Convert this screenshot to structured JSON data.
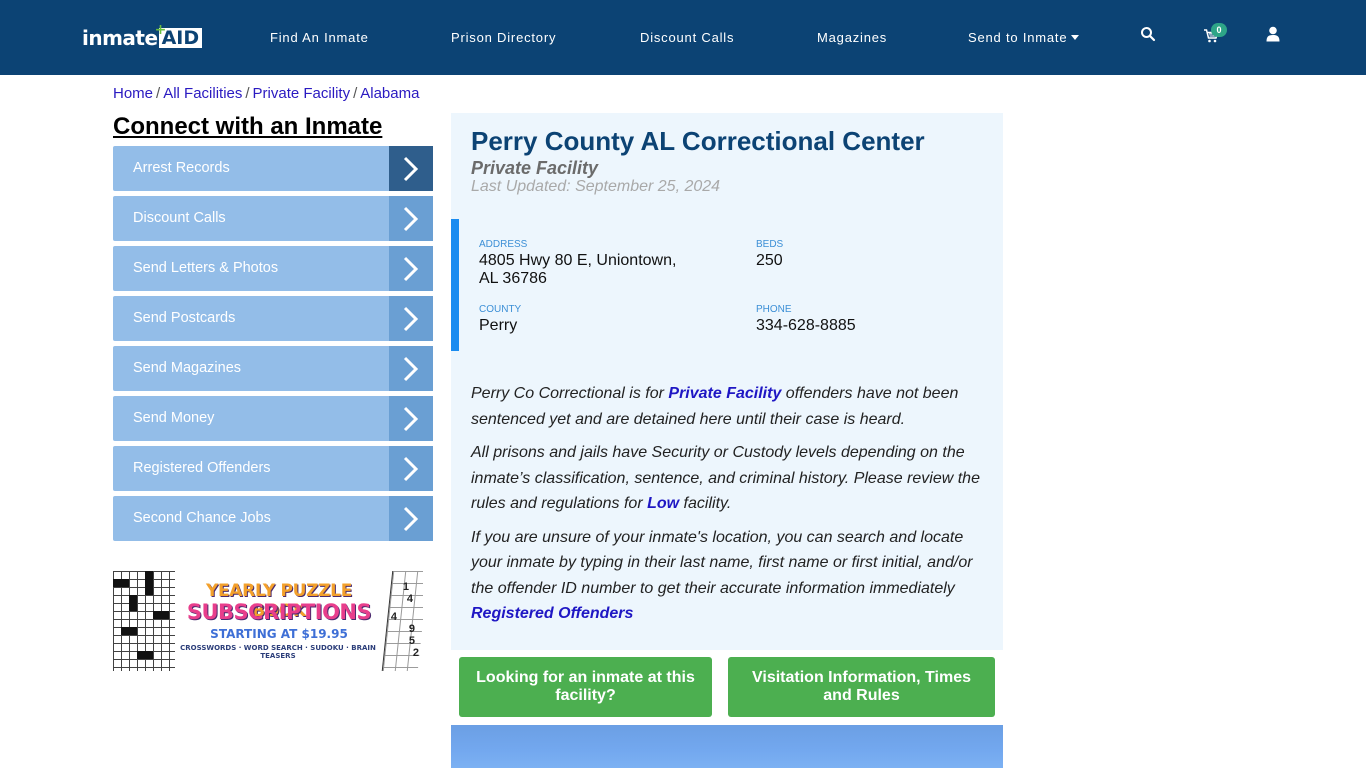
{
  "header": {
    "logo": {
      "text_main": "inmate",
      "text_accent": "AID",
      "plus": "+"
    },
    "nav": [
      {
        "label": "Find An Inmate"
      },
      {
        "label": "Prison Directory"
      },
      {
        "label": "Discount Calls"
      },
      {
        "label": "Magazines"
      },
      {
        "label": "Send to Inmate",
        "has_dropdown": true
      }
    ],
    "icons": [
      "search-icon",
      "cart-icon",
      "user-icon"
    ],
    "cart_count": "0"
  },
  "breadcrumb": {
    "items": [
      "Home",
      "All Facilities",
      "Private Facility",
      "Alabama"
    ],
    "separator": "/"
  },
  "sidebar": {
    "title": "Connect with an Inmate",
    "items": [
      {
        "label": "Arrest Records",
        "active": true
      },
      {
        "label": "Discount Calls"
      },
      {
        "label": "Send Letters & Photos"
      },
      {
        "label": "Send Postcards"
      },
      {
        "label": "Send Magazines"
      },
      {
        "label": "Send Money"
      },
      {
        "label": "Registered Offenders"
      },
      {
        "label": "Second Chance Jobs"
      }
    ],
    "ad": {
      "line1": "YEARLY PUZZLE BOOK",
      "line2": "SUBSCRIPTIONS",
      "line3": "STARTING AT $19.95",
      "line4": "CROSSWORDS · WORD SEARCH · SUDOKU · BRAIN TEASERS",
      "sudoku_numbers": [
        "1",
        "4",
        "4",
        "9",
        "5",
        "2"
      ]
    }
  },
  "facility": {
    "title": "Perry County AL Correctional Center",
    "type": "Private Facility",
    "last_updated": "Last Updated: September 25, 2024",
    "info": {
      "address_label": "ADDRESS",
      "address_line1": "4805 Hwy 80 E, Uniontown,",
      "address_line2": "AL 36786",
      "beds_label": "BEDS",
      "beds": "250",
      "county_label": "COUNTY",
      "county": "Perry",
      "phone_label": "PHONE",
      "phone": "334-628-8885"
    },
    "description": {
      "p1_before": "Perry Co Correctional is for ",
      "p1_link": "Private Facility",
      "p1_after": " offenders have not been sentenced yet and are detained here until their case is heard.",
      "p2_before": "All prisons and jails have Security or Custody levels depending on the inmate’s classification, sentence, and criminal history. Please review the rules and regulations for ",
      "p2_link": "Low",
      "p2_after": " facility.",
      "p3_text": "If you are unsure of your inmate's location, you can search and locate your inmate by typing in their last name, first name or first initial, and/or the offender ID number to get their accurate information immediately",
      "p3_link": "Registered Offenders"
    },
    "buttons": {
      "find_inmate": "Looking for an inmate at this facility?",
      "visitation": "Visitation Information, Times and Rules"
    }
  },
  "colors": {
    "header_bg": "#0c4374",
    "sidebar_item_bg": "#93bde8",
    "sidebar_arrow_bg": "#6a9fd3",
    "sidebar_arrow_active_bg": "#2f5e8c",
    "card_bg": "#edf6fd",
    "info_accent": "#1a8cf0",
    "green_button": "#4caf50",
    "link": "#1f17c4"
  }
}
